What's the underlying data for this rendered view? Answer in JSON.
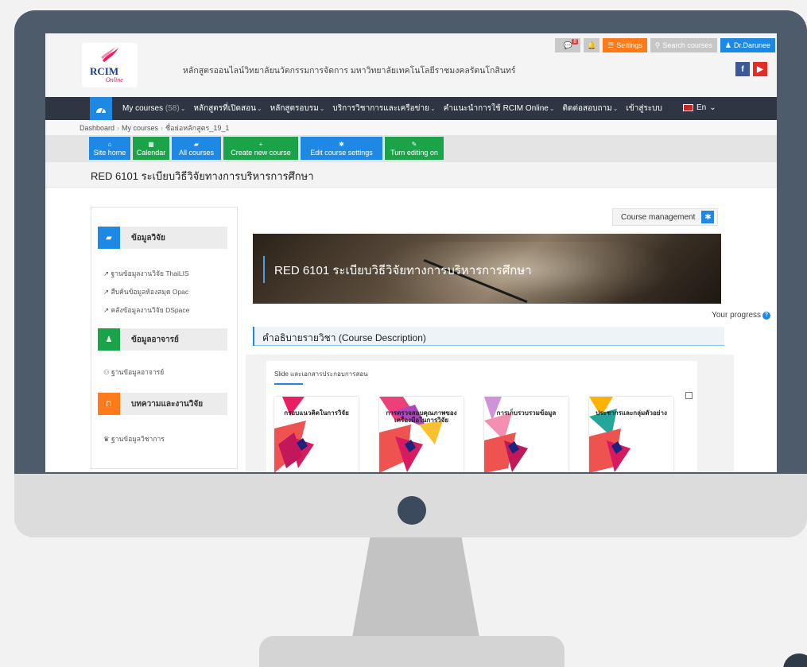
{
  "header": {
    "logo_text": "RCIM",
    "logo_sub": "Online",
    "site_name": "หลักสูตรออนไลน์วิทยาลัยนวัตกรรมการจัดการ  มหาวิทยาลัยเทคโนโลยีราชมงคลรัตนโกสินทร์",
    "message_count": "8",
    "settings_label": "Settings",
    "search_label": "Search courses",
    "user_name": "Dr.Darunee",
    "facebook": "f",
    "youtube": "▶"
  },
  "nav": {
    "items": [
      {
        "label": "My courses",
        "count": "(58)"
      },
      {
        "label": "หลักสูตรที่เปิดสอน",
        "count": ""
      },
      {
        "label": "หลักสูตรอบรม",
        "count": ""
      },
      {
        "label": "บริการวิชาการและเครือข่าย",
        "count": ""
      },
      {
        "label": "คำแนะนำการใช้ RCIM Online",
        "count": ""
      },
      {
        "label": "ติดต่อสอบถาม",
        "count": ""
      },
      {
        "label": "เข้าสู่ระบบ",
        "count": ""
      }
    ],
    "lang": "En"
  },
  "breadcrumb": [
    "Dashboard",
    "My courses",
    "ชื่อย่อหลักสูตร_19_1"
  ],
  "toolbar": {
    "site_home": "Site home",
    "calendar": "Calendar",
    "all_courses": "All courses",
    "create_course": "Create new course",
    "edit_settings": "Edit course settings",
    "turn_editing": "Turn editing on"
  },
  "course": {
    "title": "RED 6101 ระเบียบวิธีวิจัยทางการบริหารการศึกษา",
    "management": "Course management",
    "progress": "Your progress",
    "section_title": "คำอธิบายรายวิชา (Course Description)",
    "slide_label": "Slide และเอกสารประกอบการสอน"
  },
  "sidebar": {
    "blocks": [
      {
        "title": "ข้อมูลวิจัย",
        "color": "#1e88e5",
        "links": [
          "ฐานข้อมูลงานวิจัย ThaiLIS",
          "สืบค้นข้อมูลห้องสมุด Opac",
          "คลังข้อมูลงานวิจัย DSpace"
        ]
      },
      {
        "title": "ข้อมูลอาจารย์",
        "color": "#1aa349",
        "links": [
          "ฐานข้อมูลอาจารย์"
        ]
      },
      {
        "title": "บทความและงานวิจัย",
        "color": "#ff7a18",
        "links": [
          "ฐานข้อมูลวิชาการ"
        ]
      }
    ]
  },
  "thumbnails": [
    {
      "title": "กรอบแนวคิดในการวิจัย"
    },
    {
      "title": "การตรวจสอบคุณภาพของเครื่องมือในการวิจัย"
    },
    {
      "title": "การเก็บรวบรวมข้อมูล"
    },
    {
      "title": "ประชากรและกลุ่มตัวอย่าง"
    }
  ],
  "colors": {
    "accent": "#1e88e5",
    "green": "#1aa349",
    "orange": "#ff7a18",
    "nav_bg": "#2f3542",
    "bezel": "#4d5b6b"
  }
}
